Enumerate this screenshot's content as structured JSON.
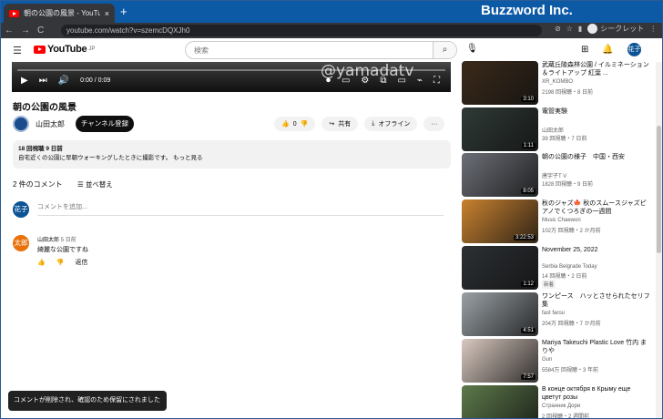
{
  "browser": {
    "tab_title": "朝の公園の風景 - YouTube",
    "tab_close": "×",
    "new_tab": "+",
    "brand": "Buzzword Inc.",
    "window_controls": "─ □ ✕",
    "url": "youtube.com/watch?v=szemcDQXJh0",
    "incognito_label": "シークレット",
    "back": "←",
    "forward": "→",
    "reload": "C"
  },
  "header": {
    "logo_text": "YouTube",
    "logo_region": "JP",
    "search_placeholder": "検索",
    "avatar_text": "花子"
  },
  "player": {
    "watermark": "@yamadatv",
    "time": "0:00 / 0:09"
  },
  "video": {
    "title": "朝の公園の風景",
    "channel": "山田太郎",
    "subscribe": "チャンネル登録",
    "likes": "0",
    "share": "共有",
    "offline": "オフライン",
    "more": "···",
    "views_date": "18 回視聴  9 日前",
    "description": "自宅近くの公園に早朝ウォーキングしたときに撮影です。 もっと見る"
  },
  "comments": {
    "count": "2 件のコメント",
    "sort": "並べ替え",
    "my_avatar": "花子",
    "placeholder": "コメントを追加...",
    "items": [
      {
        "avatar": "太郎",
        "author": "山田太郎",
        "time": "5 日前",
        "text": "綺麗な公園ですね",
        "reply": "返信"
      }
    ]
  },
  "toast": "コメントが削除され、確認のため保留にされました",
  "recommendations": [
    {
      "title": "武蔵丘陵森林公園 / イルミネーション＆ライトアップ 紅葉 ...",
      "channel": "XR_KOMBO",
      "meta": "2198 回視聴・8 日前",
      "duration": "3:10",
      "thumb": "#3b2a1a"
    },
    {
      "title": "電管実験",
      "channel": "山田太郎",
      "meta": "39 回視聴・7 日前",
      "duration": "1:11",
      "thumb": "#2f3a36"
    },
    {
      "title": "朝の公園の様子　中国・西安",
      "channel": "唐宇子T V",
      "meta": "1828 回視聴・9 日前",
      "duration": "8:05",
      "thumb": "#6c6f77"
    },
    {
      "title": "秋のジャズ🍁 秋のスムースジャズピアノでくつろぎの一週間",
      "channel": "Music Chaewon",
      "meta": "102万 回視聴・2 か月前",
      "duration": "3:22:53",
      "thumb": "#c9822f"
    },
    {
      "title": "November 25, 2022",
      "channel": "Serbia Belgrade Today",
      "meta": "14 回視聴・2 日前",
      "badge": "新着",
      "duration": "1:12",
      "thumb": "#2c3034"
    },
    {
      "title": "ワンピース　ハッとさせられたセリフ集",
      "channel": "fast farou",
      "meta": "204万 回視聴・7 か月前",
      "duration": "4:51",
      "thumb": "#9aa1a6"
    },
    {
      "title": "Mariya Takeuchi Plastic Love 竹内 まりや",
      "channel": "Gun",
      "meta": "5584万 回視聴・3 年前",
      "duration": "7:57",
      "thumb": "#d9c9c0"
    },
    {
      "title": "В конце октября в Крыму еще цветут розы",
      "channel": "Странник Дори",
      "meta": "2 回視聴・2 週間前",
      "duration": "",
      "thumb": "#5d7a4a"
    }
  ]
}
